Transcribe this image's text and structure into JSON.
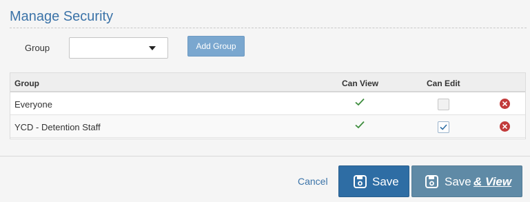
{
  "page": {
    "title": "Manage Security"
  },
  "filter": {
    "group_label": "Group",
    "group_value": "",
    "add_group_label": "Add Group"
  },
  "table": {
    "headers": {
      "group": "Group",
      "can_view": "Can View",
      "can_edit": "Can Edit"
    },
    "rows": [
      {
        "group": "Everyone",
        "can_view": true,
        "can_edit": false
      },
      {
        "group": "YCD - Detention Staff",
        "can_view": true,
        "can_edit": true
      }
    ]
  },
  "footer": {
    "cancel_label": "Cancel",
    "save_label": "Save",
    "save_view_label_prefix": "Save",
    "save_view_label_suffix": "& View"
  },
  "icons": {
    "check": "check-icon",
    "remove": "remove-icon",
    "save": "floppy-disk-icon",
    "caret": "caret-down-icon"
  },
  "colors": {
    "accent": "#3b73a8",
    "primary_button": "#2e6da4",
    "secondary_button": "#5f8aa6",
    "add_group_button": "#7aa7cf",
    "check_green": "#3c8c3c",
    "remove_red": "#c23b3b"
  }
}
